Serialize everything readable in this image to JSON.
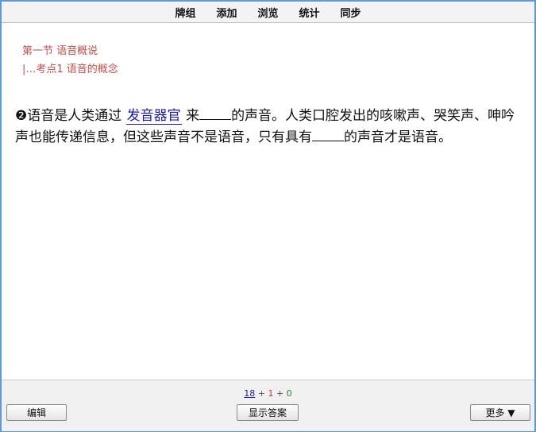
{
  "menu": {
    "items": [
      {
        "label": "牌组"
      },
      {
        "label": "添加"
      },
      {
        "label": "浏览"
      },
      {
        "label": "统计"
      },
      {
        "label": "同步"
      }
    ]
  },
  "breadcrumb": {
    "section": "第一节 语音概说",
    "subsection": "|…考点1 语音的概念"
  },
  "question": {
    "marker": "❷",
    "part1": "语音是人类通过",
    "answer": "发音器官",
    "part2": "来",
    "part3": "的声音。人类口腔发出的咳嗽声、哭笑声、呻吟声也能传递信息，但这些声音不是语音，只有具有",
    "part4": "的声音才是语音。"
  },
  "counts": {
    "new": "18",
    "learn": "1",
    "review": "0",
    "sep": "+"
  },
  "buttons": {
    "edit": "编辑",
    "show_answer": "显示答案",
    "more": "更多 ▼"
  },
  "colors": {
    "breadcrumb": "#c0504d",
    "answer": "#1a1aa6",
    "border": "#5b9bd5"
  }
}
